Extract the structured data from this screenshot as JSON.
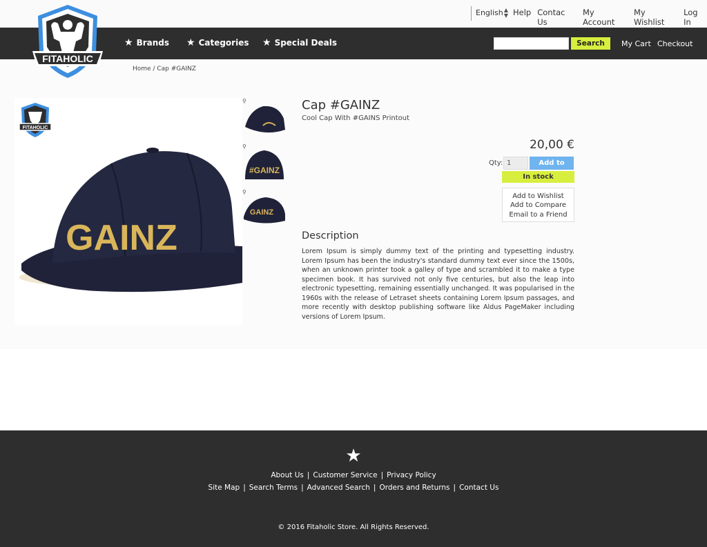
{
  "brand": {
    "logo_text": "FITAHOLIC"
  },
  "topbar": {
    "language": "English",
    "links": [
      "Help",
      "Contac Us",
      "My Account",
      "My Wishlist",
      "Log In"
    ]
  },
  "nav": {
    "brands": "Brands",
    "categories": "Categories",
    "special_deals": "Special Deals",
    "search_placeholder": "",
    "search_button": "Search",
    "my_cart": "My Cart",
    "checkout": "Checkout"
  },
  "breadcrumb": "Home / Cap #GAINZ",
  "product": {
    "title": "Cap #GAINZ",
    "subtitle": "Cool Cap With #GAINS Printout",
    "price": "20,00 €",
    "qty_label": "Qty:",
    "qty_value": "1",
    "add_to_cart": "Add to Cart",
    "stock": "In stock",
    "add_to_wishlist": "Add to Wishlist",
    "add_to_compare": "Add to Compare",
    "email_friend": "Email to a Friend",
    "image_text": "GAINZ",
    "thumb_text": "#GAINZ",
    "description_title": "Description",
    "description": "Lorem Ipsum is simply dummy text of the printing and typesetting industry. Lorem Ipsum has been the industry's standard dummy text ever since the 1500s, when an unknown printer took a galley of type and scrambled it to make a type specimen book. It has survived not only five centuries, but also the leap into electronic typesetting, remaining essentially unchanged. It was popularised in the 1960s with the release of Letraset sheets containing Lorem Ipsum passages, and more recently with desktop publishing software like Aldus PageMaker including versions of Lorem Ipsum."
  },
  "footer": {
    "row1": [
      "About Us",
      "Customer Service",
      "Privacy Policy"
    ],
    "row2": [
      "Site Map",
      "Search Terms",
      "Advanced Search",
      "Orders and Returns",
      "Contact Us"
    ],
    "copyright": "© 2016 Fitaholic Store. All Rights Reserved."
  },
  "colors": {
    "nav_bg": "#2e2e2e",
    "accent_yellow": "#d8ee3e",
    "accent_blue": "#6fb4ee",
    "logo_blue": "#3d8fe0",
    "cap_navy": "#1f2238",
    "cap_gold": "#d9b65a"
  }
}
